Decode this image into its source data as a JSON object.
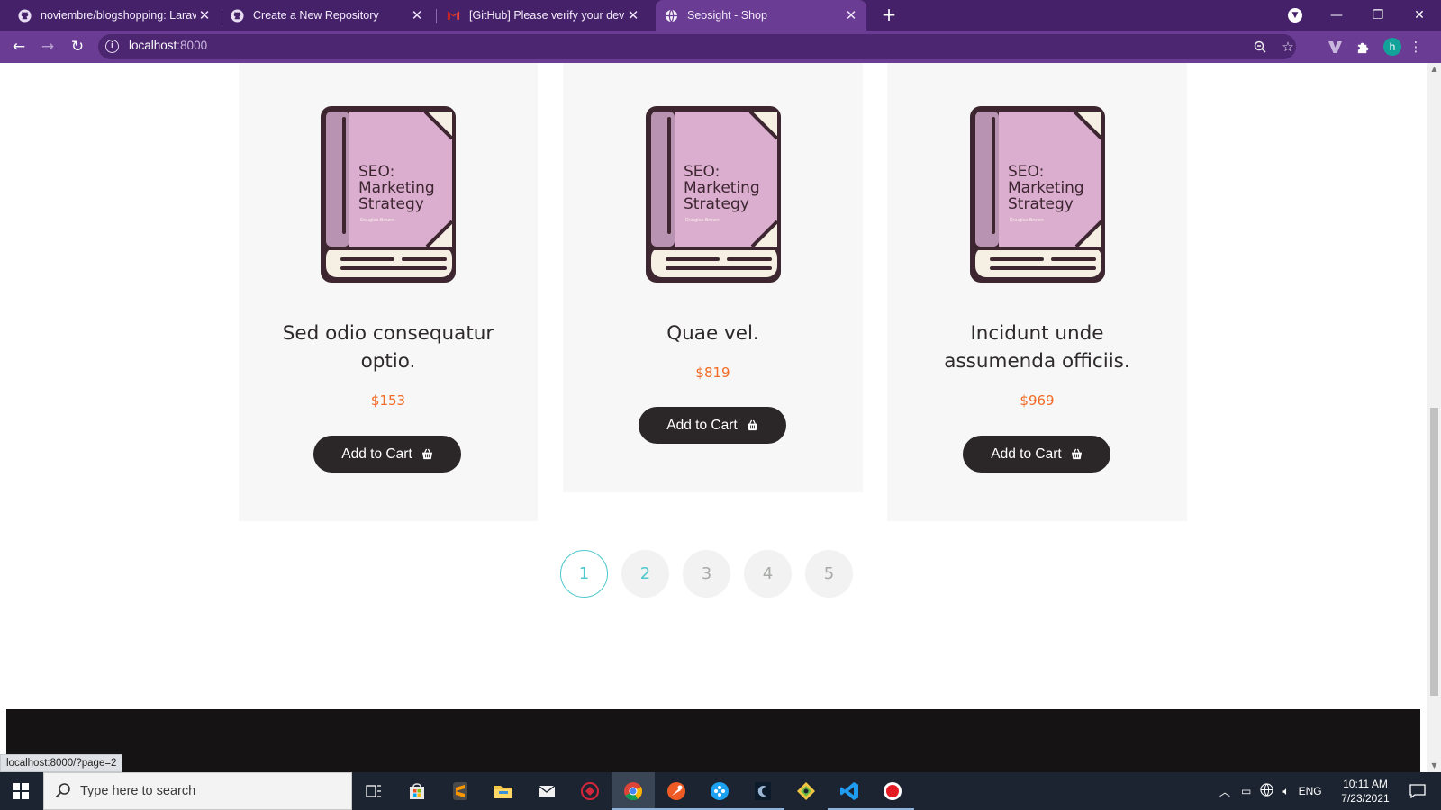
{
  "browser": {
    "tabs": [
      {
        "title": "noviembre/blogshopping: Larave",
        "icon": "github-icon"
      },
      {
        "title": "Create a New Repository",
        "icon": "github-icon"
      },
      {
        "title": "[GitHub] Please verify your devic",
        "icon": "gmail-icon"
      },
      {
        "title": "Seosight - Shop",
        "icon": "globe-icon",
        "active": true
      }
    ],
    "url_host": "localhost",
    "url_port": ":8000",
    "status_link": "localhost:8000/?page=2",
    "profile_initial": "h",
    "theme_color": "#6a3c93"
  },
  "shop": {
    "book_cover": {
      "line1": "SEO:",
      "line2": "Marketing",
      "line3": "Strategy",
      "author": "Douglas Brown"
    },
    "products": [
      {
        "title_line1": "Sed odio consequatur",
        "title_line2": "optio.",
        "price": "$153",
        "button": "Add to Cart"
      },
      {
        "title_line1": "Quae vel.",
        "title_line2": "",
        "price": "$819",
        "button": "Add to Cart"
      },
      {
        "title_line1": "Incidunt unde",
        "title_line2": "assumenda officiis.",
        "price": "$969",
        "button": "Add to Cart"
      }
    ],
    "pagination": [
      "1",
      "2",
      "3",
      "4",
      "5"
    ],
    "current_page": "1",
    "accent_color": "#4ec8cc",
    "price_color": "#f26a25"
  },
  "taskbar": {
    "search_placeholder": "Type here to search",
    "language": "ENG",
    "time": "10:11 AM",
    "date": "7/23/2021"
  }
}
